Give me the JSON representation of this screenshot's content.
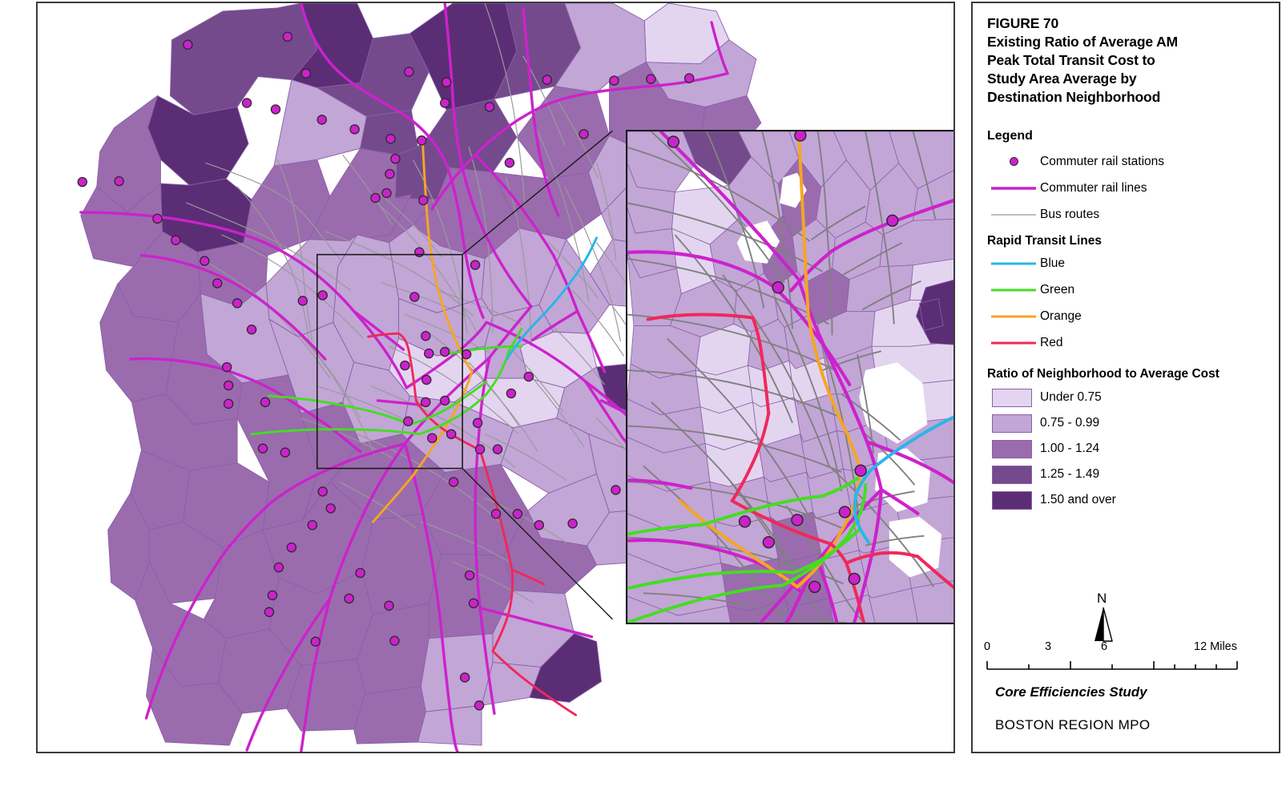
{
  "figure": {
    "number": "FIGURE 70",
    "title_line1": "Existing Ratio of Average AM",
    "title_line2": "Peak Total Transit Cost to",
    "title_line3": "Study Area Average by",
    "title_line4": "Destination Neighborhood"
  },
  "legend": {
    "heading": "Legend",
    "items": [
      {
        "label": "Commuter rail stations",
        "symbol": "point",
        "color": "#cc22cc"
      },
      {
        "label": "Commuter rail lines",
        "symbol": "line",
        "color": "#cc22cc",
        "width": 3.2
      },
      {
        "label": "Bus routes",
        "symbol": "line",
        "color": "#a8a8a8",
        "width": 1.4
      }
    ],
    "rapid_transit_heading": "Rapid Transit Lines",
    "rapid_transit": [
      {
        "label": "Blue",
        "color": "#29b6e8",
        "width": 2.8
      },
      {
        "label": "Green",
        "color": "#44dd22",
        "width": 2.8
      },
      {
        "label": "Orange",
        "color": "#f5a623",
        "width": 2.8
      },
      {
        "label": "Red",
        "color": "#f0285a",
        "width": 2.8
      }
    ],
    "classification_heading": "Ratio of Neighborhood to Average Cost",
    "classes": [
      {
        "label": "Under 0.75",
        "color": "#e3d5f0"
      },
      {
        "label": "0.75 - 0.99",
        "color": "#c2a6d6"
      },
      {
        "label": "1.00 - 1.24",
        "color": "#9a6cae"
      },
      {
        "label": "1.25 - 1.49",
        "color": "#744a8c"
      },
      {
        "label": "1.50 and over",
        "color": "#5b2d75"
      }
    ]
  },
  "north_arrow": {
    "letter": "N"
  },
  "scalebar": {
    "ticks": [
      "0",
      "3",
      "6",
      "12 Miles"
    ],
    "unit": "Miles",
    "major_values": [
      0,
      3,
      6,
      12
    ]
  },
  "footer": {
    "study": "Core Efficiencies Study",
    "agency": "BOSTON REGION MPO"
  },
  "chart_data": {
    "type": "map",
    "title": "Existing Ratio of Average AM Peak Total Transit Cost to Study Area Average by Destination Neighborhood",
    "region": "Boston Region MPO study area",
    "measure": "Ratio of neighborhood average AM peak total transit cost to study area average",
    "class_breaks": [
      {
        "range": "Under 0.75",
        "color": "#e3d5f0"
      },
      {
        "range": "0.75 - 0.99",
        "color": "#c2a6d6"
      },
      {
        "range": "1.00 - 1.24",
        "color": "#9a6cae"
      },
      {
        "range": "1.25 - 1.49",
        "color": "#744a8c"
      },
      {
        "range": "1.50 and over",
        "color": "#5b2d75"
      }
    ],
    "overlays": [
      {
        "name": "Commuter rail stations",
        "style": "point",
        "color": "#cc22cc"
      },
      {
        "name": "Commuter rail lines",
        "style": "line",
        "color": "#cc22cc"
      },
      {
        "name": "Bus routes",
        "style": "line",
        "color": "#a8a8a8"
      },
      {
        "name": "Blue Line",
        "style": "line",
        "color": "#29b6e8"
      },
      {
        "name": "Green Line",
        "style": "line",
        "color": "#44dd22"
      },
      {
        "name": "Orange Line",
        "style": "line",
        "color": "#f5a623"
      },
      {
        "name": "Red Line",
        "style": "line",
        "color": "#f0285a"
      }
    ],
    "scale": {
      "min": 0,
      "max": 12,
      "unit": "Miles",
      "labeled_ticks": [
        0,
        3,
        6,
        12
      ]
    }
  }
}
